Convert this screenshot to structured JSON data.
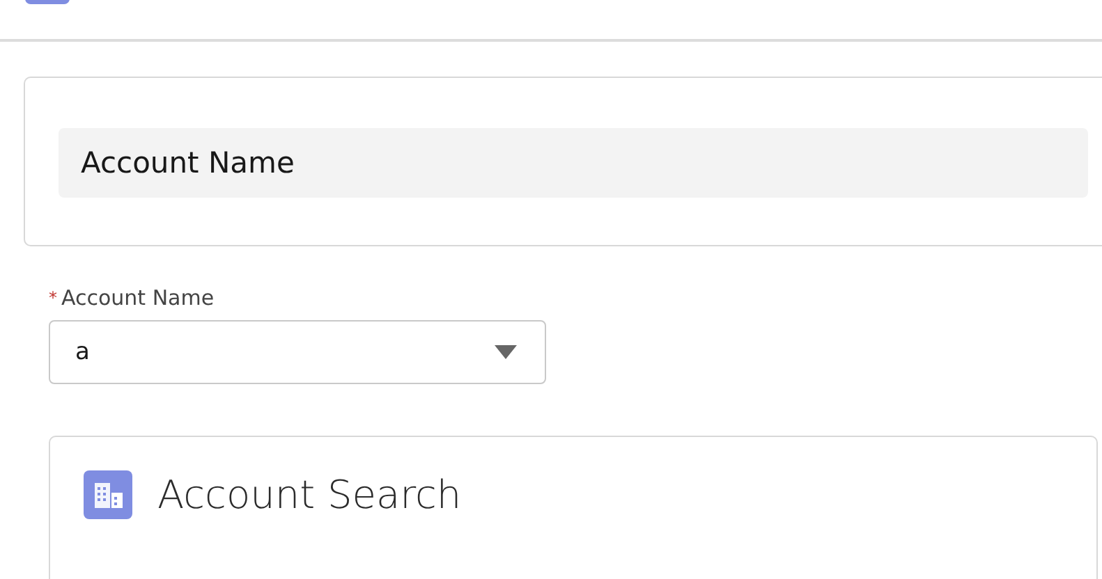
{
  "section": {
    "title": "Account Name"
  },
  "field": {
    "label": "Account Name",
    "required": true,
    "required_mark": "*",
    "value": "a"
  },
  "card": {
    "title": "Account Search"
  }
}
